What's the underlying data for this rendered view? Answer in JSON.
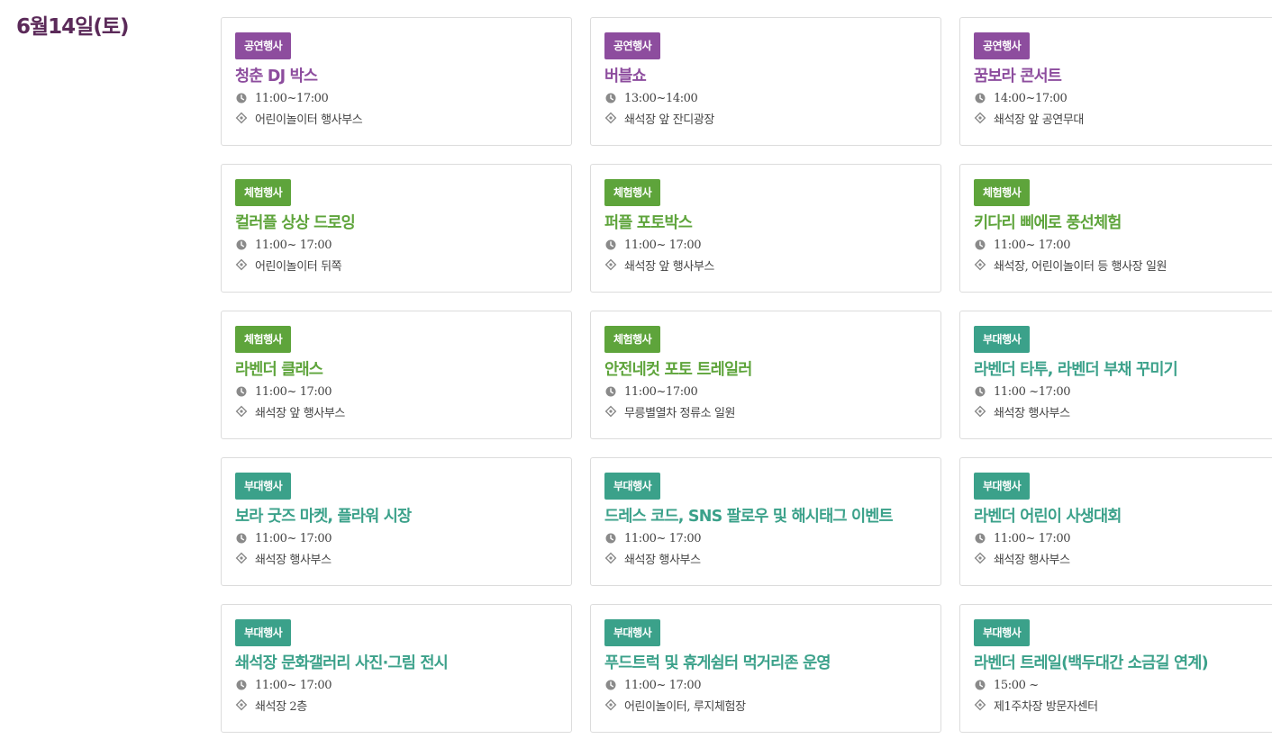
{
  "page": {
    "date_title": "6월14일(토)"
  },
  "colors": {
    "date": "#5b2a59",
    "performance": "#8d4d9e",
    "experience": "#5ea43b",
    "side_event": "#3ba18a",
    "icon": "#8a8a8a"
  },
  "icons": {
    "time": "clock-icon",
    "place": "location-icon"
  },
  "events": [
    {
      "category": "공연행사",
      "type": "performance",
      "title": "청춘 DJ 박스",
      "time": "11:00~17:00",
      "place": "어린이놀이터 행사부스"
    },
    {
      "category": "공연행사",
      "type": "performance",
      "title": "버블쇼",
      "time": "13:00~14:00",
      "place": "쇄석장 앞 잔디광장"
    },
    {
      "category": "공연행사",
      "type": "performance",
      "title": "꿈보라 콘서트",
      "time": "14:00~17:00",
      "place": "쇄석장 앞 공연무대"
    },
    {
      "category": "체험행사",
      "type": "experience",
      "title": "컬러플 상상 드로잉",
      "time": "11:00~ 17:00",
      "place": "어린이놀이터 뒤쪽"
    },
    {
      "category": "체험행사",
      "type": "experience",
      "title": "퍼플 포토박스",
      "time": "11:00~ 17:00",
      "place": "쇄석장 앞 행사부스"
    },
    {
      "category": "체험행사",
      "type": "experience",
      "title": "키다리 삐에로 풍선체험",
      "time": "11:00~ 17:00",
      "place": "쇄석장, 어린이놀이터 등 행사장 일원"
    },
    {
      "category": "체험행사",
      "type": "experience",
      "title": "라벤더 클래스",
      "time": "11:00~ 17:00",
      "place": "쇄석장 앞 행사부스"
    },
    {
      "category": "체험행사",
      "type": "experience",
      "title": "안전네컷 포토 트레일러",
      "time": "11:00~17:00",
      "place": "무릉별열차 정류소 일원"
    },
    {
      "category": "부대행사",
      "type": "side_event",
      "title": "라벤더 타투, 라벤더 부채 꾸미기",
      "time": "11:00 ~17:00",
      "place": "쇄석장 행사부스"
    },
    {
      "category": "부대행사",
      "type": "side_event",
      "title": "보라 굿즈 마켓, 플라워 시장",
      "time": "11:00~ 17:00",
      "place": "쇄석장 행사부스"
    },
    {
      "category": "부대행사",
      "type": "side_event",
      "title": "드레스 코드, SNS 팔로우 및 해시태그 이벤트",
      "time": "11:00~ 17:00",
      "place": "쇄석장 행사부스"
    },
    {
      "category": "부대행사",
      "type": "side_event",
      "title": "라벤더 어린이 사생대회",
      "time": "11:00~ 17:00",
      "place": "쇄석장 행사부스"
    },
    {
      "category": "부대행사",
      "type": "side_event",
      "title": "쇄석장 문화갤러리 사진·그림 전시",
      "time": "11:00~ 17:00",
      "place": "쇄석장 2층"
    },
    {
      "category": "부대행사",
      "type": "side_event",
      "title": "푸드트럭 및 휴게쉼터 먹거리존 운영",
      "time": "11:00~ 17:00",
      "place": "어린이놀이터, 루지체험장"
    },
    {
      "category": "부대행사",
      "type": "side_event",
      "title": "라벤더 트레일(백두대간 소금길 연계)",
      "time": "15:00 ~",
      "place": "제1주차장 방문자센터"
    }
  ]
}
